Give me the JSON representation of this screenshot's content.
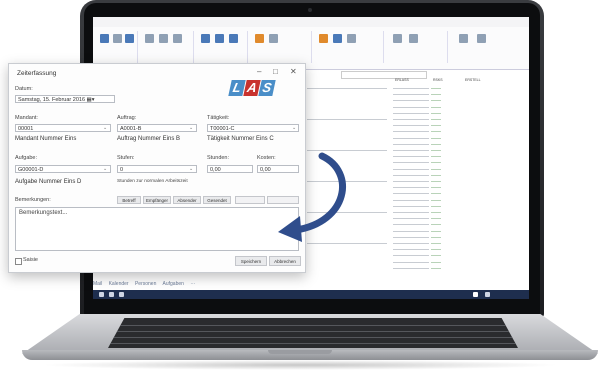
{
  "dialog": {
    "title": "Zeiterfassung",
    "date_label": "Datum:",
    "date_weekday": "Samstag",
    "date_day": "15",
    "date_month": "Februar",
    "date_year": "2016",
    "mandant_label": "Mandant:",
    "mandant_value": "00001",
    "mandant_desc": "Mandant Nummer Eins",
    "auftrag_label": "Auftrag:",
    "auftrag_value": "A0001-B",
    "auftrag_desc": "Auftrag Nummer Eins B",
    "taetigkeit_label": "Tätigkeit:",
    "taetigkeit_value": "T00001-C",
    "taetigkeit_desc": "Tätigkeit Nummer Eins C",
    "aufgabe_label": "Aufgabe:",
    "aufgabe_value": "G00001-D",
    "aufgabe_desc": "Aufgabe Nummer Eins D",
    "stufen_label": "Stufen:",
    "stufen_value": "0",
    "stufen_desc": "Stunden zur normalen Arbeitszeit",
    "stunden_label": "Stunden:",
    "stunden_value": "0,00",
    "kosten_label": "Kosten:",
    "kosten_value": "0,00",
    "bemerkungen_label": "Bemerkungen:",
    "bemerkungen_value": "Bemerkungstext...",
    "buttons": [
      "Betreff",
      "Empfänger",
      "Absender",
      "Gesendet"
    ],
    "disabled_buttons": [
      "",
      ""
    ],
    "checkbox_label": "Saisie",
    "save_label": "Speichern",
    "cancel_label": "Abbrechen",
    "window_controls": [
      "–",
      "□",
      "✕"
    ],
    "logo": "LAS"
  },
  "app": {
    "bottom_tabs": [
      "Mail",
      "Kalender",
      "Personen",
      "Aufgaben",
      "···"
    ],
    "columns": [
      "ERLASS",
      "RSKS",
      "ERSTELL"
    ]
  },
  "colors": {
    "logo_blue": "#4a8ec8",
    "logo_red": "#c8322e",
    "arrow_blue": "#2f4d8c",
    "taskbar": "#1e2e4e"
  },
  "icons": [
    "close-icon",
    "minimize-icon",
    "maximize-icon",
    "chevron-down-icon",
    "curved-arrow-icon",
    "calendar-spin-icon"
  ]
}
